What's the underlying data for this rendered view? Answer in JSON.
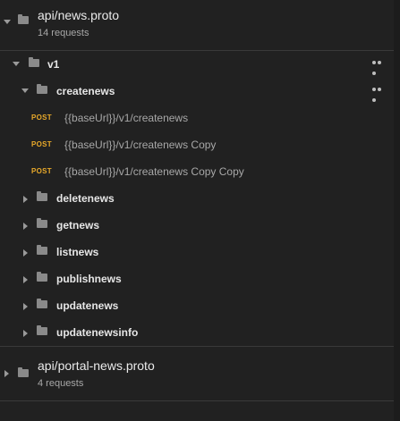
{
  "collections": [
    {
      "name": "api/news.proto",
      "count_text": "14 requests",
      "expanded": true
    },
    {
      "name": "api/portal-news.proto",
      "count_text": "4 requests",
      "expanded": false
    }
  ],
  "tree": {
    "root_folder": {
      "label": "v1",
      "expanded": true
    },
    "open_folder": {
      "label": "createnews",
      "expanded": true
    },
    "requests": [
      {
        "method": "POST",
        "name": "{{baseUrl}}/v1/createnews"
      },
      {
        "method": "POST",
        "name": "{{baseUrl}}/v1/createnews Copy"
      },
      {
        "method": "POST",
        "name": "{{baseUrl}}/v1/createnews Copy Copy"
      }
    ],
    "folders": [
      {
        "label": "deletenews"
      },
      {
        "label": "getnews"
      },
      {
        "label": "listnews"
      },
      {
        "label": "publishnews"
      },
      {
        "label": "updatenews"
      },
      {
        "label": "updatenewsinfo"
      }
    ]
  },
  "colors": {
    "background": "#212121",
    "method_post": "#e8a92a",
    "text_primary": "#e6e6e6",
    "text_secondary": "#a8a8a8"
  },
  "icons": {
    "folder": "folder-icon",
    "expand": "caret-down-icon",
    "collapse": "caret-right-icon",
    "more": "more-options-icon"
  }
}
